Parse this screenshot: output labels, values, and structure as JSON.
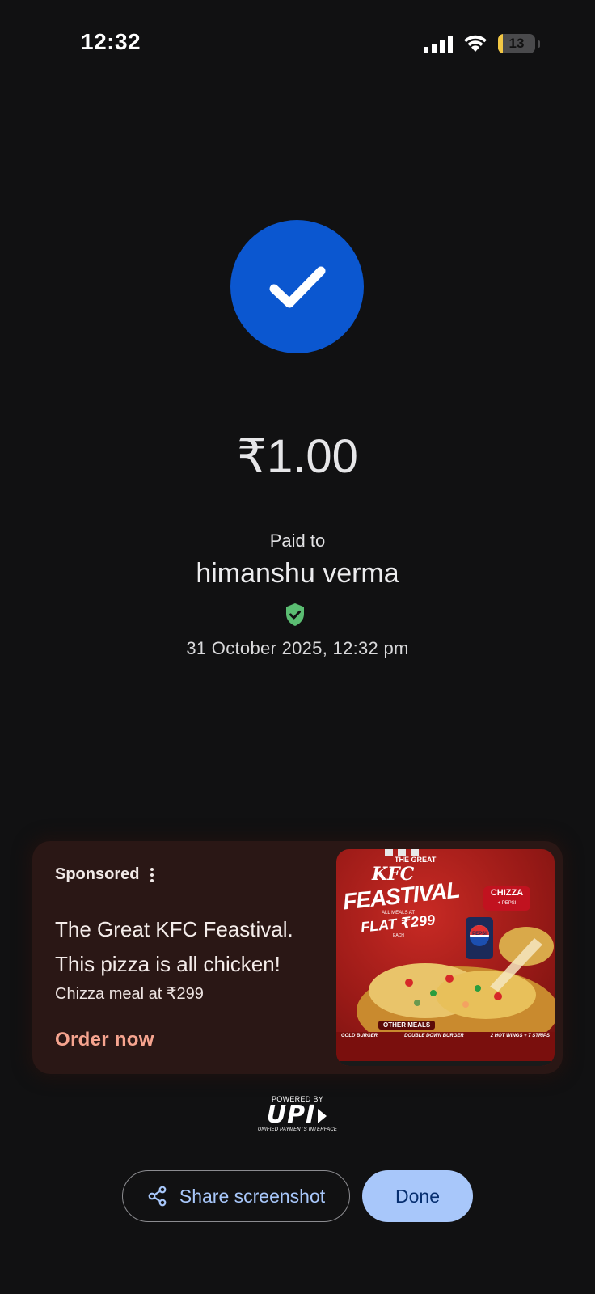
{
  "status_bar": {
    "time": "12:32",
    "battery_level": "13",
    "icons": [
      "signal-icon",
      "wifi-icon",
      "battery-icon"
    ]
  },
  "payment": {
    "status_icon": "check-circle-icon",
    "amount": "₹1.00",
    "paid_to_label": "Paid to",
    "payee_name": "himanshu verma",
    "verified_icon": "verified-shield-icon",
    "datetime": "31 October 2025, 12:32 pm"
  },
  "ad": {
    "sponsored_label": "Sponsored",
    "headline": "The Great KFC Feastival. This pizza is all chicken!",
    "subtext": "Chizza meal at ₹299",
    "cta": "Order now",
    "image": {
      "top_text": "THE GREAT",
      "brand": "KFC",
      "title": "FEASTIVAL",
      "offer_small": "ALL MEALS AT",
      "offer": "FLAT ₹299",
      "offer_each": "EACH",
      "badge": "CHIZZA",
      "badge_sub": "+ PEPSI",
      "drink": "PEPSI",
      "other_meals": "OTHER MEALS",
      "meals": [
        "GOLD BURGER",
        "DOUBLE DOWN BURGER",
        "2 HOT WINGS + 7 STRIPS"
      ]
    }
  },
  "footer": {
    "powered_by": "POWERED BY",
    "upi_logo": "UPI",
    "upi_full": "UNIFIED PAYMENTS INTERFACE"
  },
  "actions": {
    "share_label": "Share screenshot",
    "done_label": "Done"
  },
  "colors": {
    "background": "#111112",
    "success_blue": "#0b57d0",
    "verified_green": "#5bbd72",
    "accent_light_blue": "#a8c7fa",
    "cta_salmon": "#f6a48f",
    "battery_yellow": "#f2c744"
  }
}
